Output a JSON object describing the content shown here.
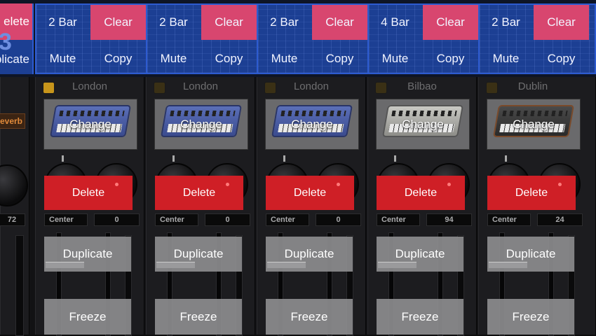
{
  "clips": {
    "partial": {
      "top_label": "elete",
      "number": "3",
      "bottom_label": "plicate"
    },
    "items": [
      {
        "length": "2 Bar",
        "clear": "Clear",
        "mute": "Mute",
        "copy": "Copy"
      },
      {
        "length": "2 Bar",
        "clear": "Clear",
        "mute": "Mute",
        "copy": "Copy"
      },
      {
        "length": "2 Bar",
        "clear": "Clear",
        "mute": "Mute",
        "copy": "Copy"
      },
      {
        "length": "4 Bar",
        "clear": "Clear",
        "mute": "Mute",
        "copy": "Copy"
      },
      {
        "length": "2 Bar",
        "clear": "Clear",
        "mute": "Mute",
        "copy": "Copy"
      }
    ]
  },
  "partial_strip": {
    "effect": "everb",
    "value": "72"
  },
  "strips": [
    {
      "name": "London",
      "change": "Change",
      "delete": "Delete",
      "pan": "Center",
      "value": "0",
      "duplicate": "Duplicate",
      "freeze": "Freeze",
      "led": "amber",
      "synth": "blue-drum-machine"
    },
    {
      "name": "London",
      "change": "Change",
      "delete": "Delete",
      "pan": "Center",
      "value": "0",
      "duplicate": "Duplicate",
      "freeze": "Freeze",
      "led": "dim",
      "synth": "blue-drum-machine"
    },
    {
      "name": "London",
      "change": "Change",
      "delete": "Delete",
      "pan": "Center",
      "value": "0",
      "duplicate": "Duplicate",
      "freeze": "Freeze",
      "led": "dim",
      "synth": "blue-drum-machine"
    },
    {
      "name": "Bilbao",
      "change": "Change",
      "delete": "Delete",
      "pan": "Center",
      "value": "94",
      "duplicate": "Duplicate",
      "freeze": "Freeze",
      "led": "dim",
      "synth": "grey-step-sequencer"
    },
    {
      "name": "Dublin",
      "change": "Change",
      "delete": "Delete",
      "pan": "Center",
      "value": "24",
      "duplicate": "Duplicate",
      "freeze": "Freeze",
      "led": "dim",
      "synth": "dark-analog-synth"
    }
  ],
  "colors": {
    "clip_blue": "#1c3f93",
    "clip_pink": "#d8466f",
    "delete_red": "#cf1f26",
    "led_amber": "#c7951b"
  }
}
